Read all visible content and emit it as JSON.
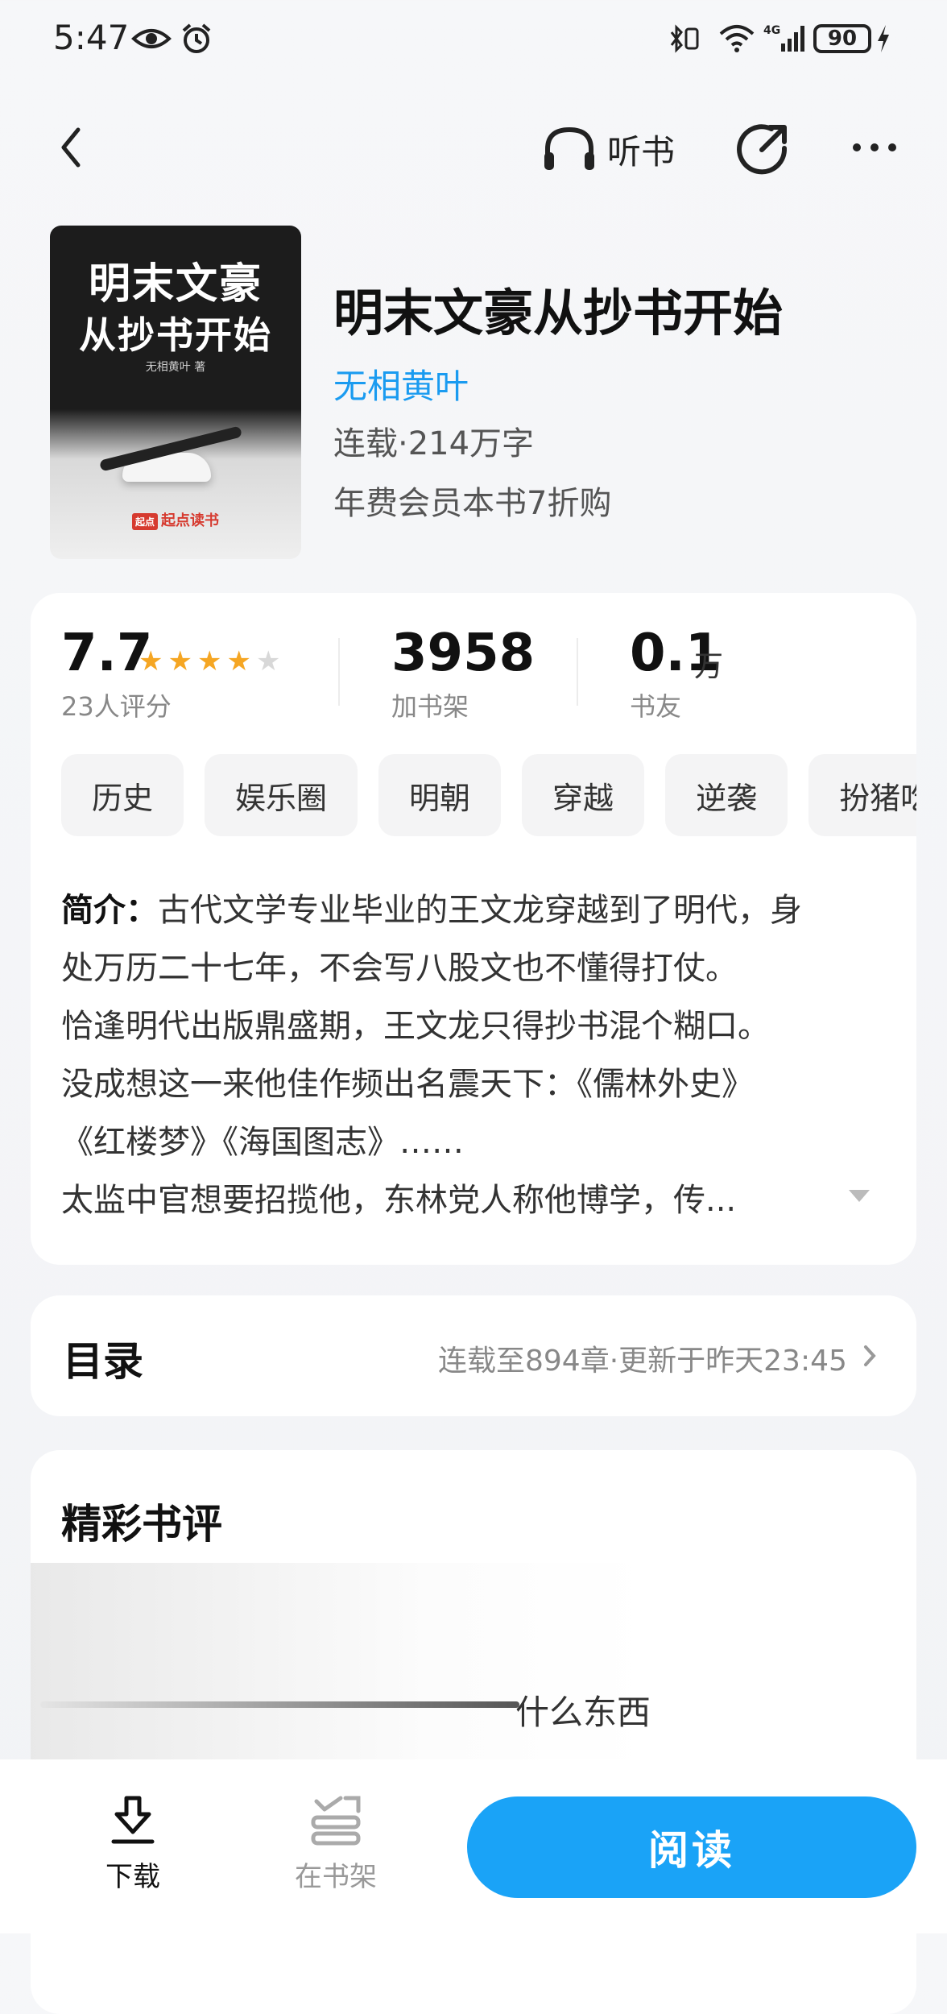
{
  "status_bar": {
    "time": "5:47",
    "network": "4G",
    "battery": "90"
  },
  "nav": {
    "listen_label": "听书"
  },
  "book": {
    "cover_title_line1": "明末文豪",
    "cover_title_line2": "从抄书开始",
    "cover_author": "无相黄叶 著",
    "cover_brand_badge": "起点",
    "cover_brand": "起点读书",
    "title": "明末文豪从抄书开始",
    "author": "无相黄叶",
    "status": "连载·214万字",
    "vip_offer": "年费会员本书7折购"
  },
  "stats": {
    "rating": "7.7",
    "stars_filled": 4,
    "stars_total": 5,
    "rating_count": "23人评分",
    "shelf_count": "3958",
    "shelf_label": "加书架",
    "friends_count": "0.1",
    "friends_unit": "万",
    "friends_label": "书友"
  },
  "tags": [
    "历史",
    "娱乐圈",
    "明朝",
    "穿越",
    "逆袭",
    "扮猪吃虎"
  ],
  "intro": {
    "label": "简介：",
    "line1": "古代文学专业毕业的王文龙穿越到了明代，身",
    "line2": "处万历二十七年，不会写八股文也不懂得打仗。",
    "line3": "恰逢明代出版鼎盛期，王文龙只得抄书混个糊口。",
    "line4": "没成想这一来他佳作频出名震天下：《儒林外史》",
    "line5": "《红楼梦》《海国图志》……",
    "line6": "太监中官想要招揽他，东林党人称他博学，传..."
  },
  "toc": {
    "title": "目录",
    "meta": "连载至894章·更新于昨天23:45"
  },
  "reviews": {
    "title": "精彩书评",
    "preview_text": "什么东西"
  },
  "bottom_bar": {
    "download_label": "下载",
    "shelf_label": "在书架",
    "read_label": "阅读"
  },
  "colors": {
    "accent": "#1aa3f7",
    "author_link": "#1a9bf0",
    "star": "#f5a623"
  }
}
